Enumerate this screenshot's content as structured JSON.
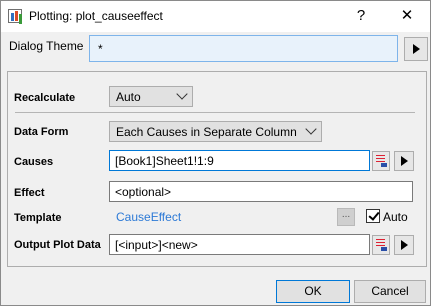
{
  "window": {
    "title": "Plotting: plot_causeeffect",
    "help_glyph": "?",
    "close_glyph": "✕"
  },
  "theme": {
    "label": "Dialog Theme",
    "value": "*"
  },
  "recalculate": {
    "label": "Recalculate",
    "value": "Auto"
  },
  "data_form": {
    "label": "Data Form",
    "value": "Each Causes in Separate Column"
  },
  "causes": {
    "label": "Causes",
    "value": "[Book1]Sheet1!1:9"
  },
  "effect": {
    "label": "Effect",
    "value": "<optional>"
  },
  "template": {
    "label": "Template",
    "value": "CauseEffect",
    "browse_label": "...",
    "auto_label": "Auto",
    "auto_checked": true
  },
  "output": {
    "label": "Output Plot Data",
    "value": "[<input>]<new>"
  },
  "buttons": {
    "ok": "OK",
    "cancel": "Cancel"
  },
  "colors": {
    "link": "#2d7ad6",
    "focus_border": "#0078d7",
    "theme_field_bg": "#e8f2fb"
  }
}
